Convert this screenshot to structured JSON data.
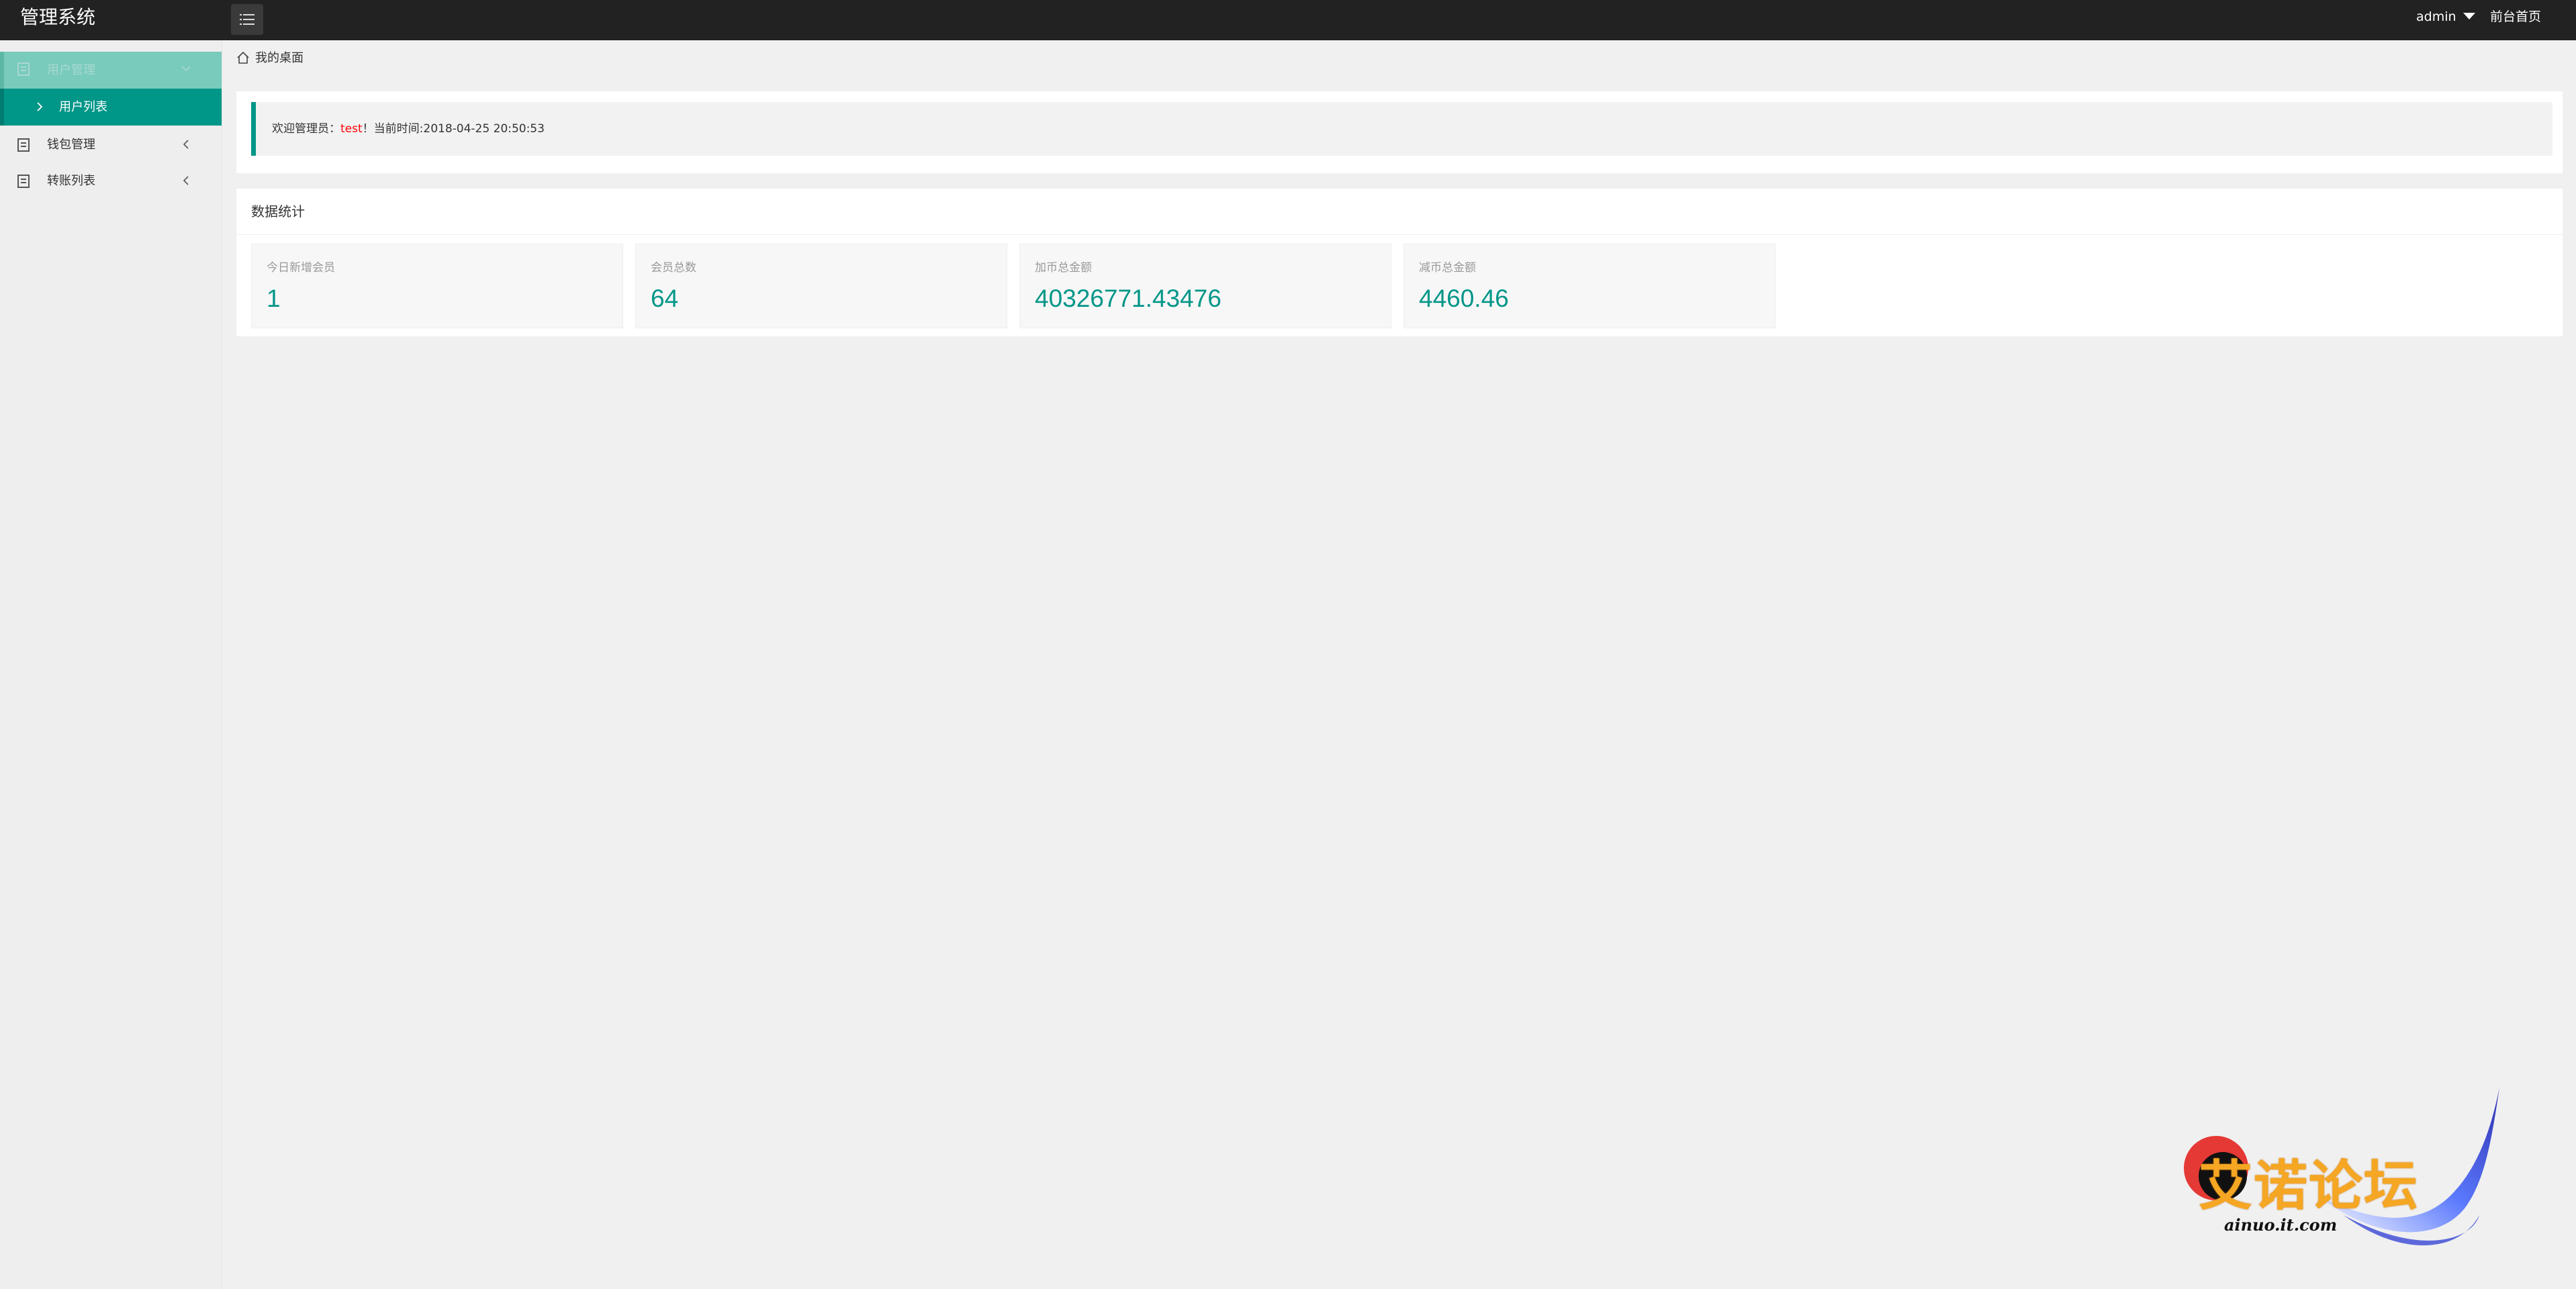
{
  "app": {
    "title": "管理系统"
  },
  "header": {
    "user_label": "admin",
    "front_link_label": "前台首页"
  },
  "sidebar": {
    "groups": [
      {
        "label": "用户管理",
        "icon": "page-icon",
        "state": "expanded",
        "arrow": "chevron-down-icon",
        "items": [
          {
            "label": "用户列表",
            "active": true
          }
        ]
      },
      {
        "label": "钱包管理",
        "icon": "page-icon",
        "state": "collapsed",
        "arrow": "chevron-left-icon"
      },
      {
        "label": "转账列表",
        "icon": "page-icon",
        "state": "collapsed",
        "arrow": "chevron-left-icon"
      }
    ]
  },
  "breadcrumb": {
    "label": "我的桌面",
    "icon": "home-icon"
  },
  "welcome": {
    "prefix": "欢迎管理员：",
    "admin_name": "test",
    "suffix": "！当前时间:2018-04-25 20:50:53"
  },
  "stats": {
    "title": "数据统计",
    "items": [
      {
        "label": "今日新增会员",
        "value": "1"
      },
      {
        "label": "会员总数",
        "value": "64"
      },
      {
        "label": "加币总金额",
        "value": "40326771.43476"
      },
      {
        "label": "减币总金额",
        "value": "4460.46"
      }
    ]
  },
  "watermark": {
    "title": "艾诺论坛",
    "domain": "ainuo.it.com"
  },
  "colors": {
    "header_bg": "#222222",
    "accent": "#009688",
    "accent_light": "#79cbbc",
    "admin_name": "#ff0000",
    "page_bg": "#f0f0f0"
  }
}
